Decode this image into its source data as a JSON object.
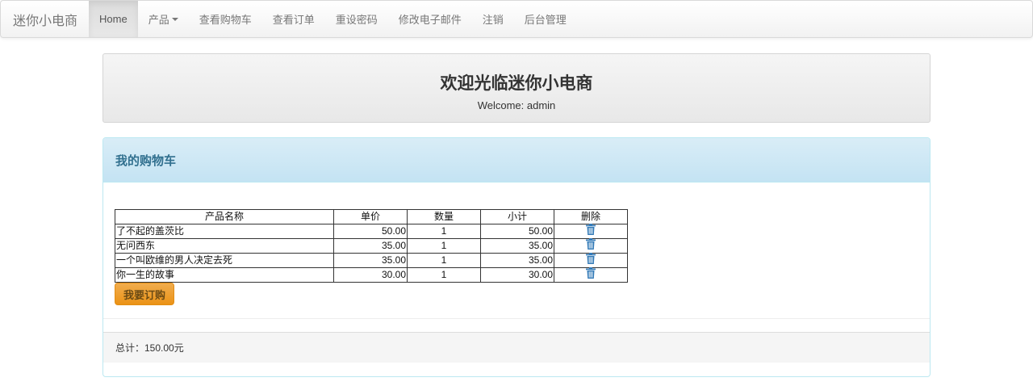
{
  "navbar": {
    "brand": "迷你小电商",
    "items": [
      {
        "label": "Home",
        "active": true
      },
      {
        "label": "产品",
        "dropdown": true
      },
      {
        "label": "查看购物车"
      },
      {
        "label": "查看订单"
      },
      {
        "label": "重设密码"
      },
      {
        "label": "修改电子邮件"
      },
      {
        "label": "注销"
      },
      {
        "label": "后台管理"
      }
    ]
  },
  "welcome": {
    "title": "欢迎光临迷你小电商",
    "subtitle": "Welcome: admin"
  },
  "cart": {
    "heading": "我的购物车",
    "columns": [
      "产品名称",
      "单价",
      "数量",
      "小计",
      "删除"
    ],
    "rows": [
      {
        "name": "了不起的盖茨比",
        "price": "50.00",
        "qty": "1",
        "subtotal": "50.00",
        "delete_icon": "trash-icon"
      },
      {
        "name": "无问西东",
        "price": "35.00",
        "qty": "1",
        "subtotal": "35.00",
        "delete_icon": "trash-icon"
      },
      {
        "name": "一个叫欧维的男人决定去死",
        "price": "35.00",
        "qty": "1",
        "subtotal": "35.00",
        "delete_icon": "trash-icon"
      },
      {
        "name": "你一生的故事",
        "price": "30.00",
        "qty": "1",
        "subtotal": "30.00",
        "delete_icon": "trash-icon"
      }
    ],
    "order_button": "我要订购",
    "total_text": "总计：150.00元"
  },
  "colors": {
    "panel_heading_text": "#31708f",
    "order_button": "#f0ad4e",
    "trash_icon": "#337ab7"
  }
}
